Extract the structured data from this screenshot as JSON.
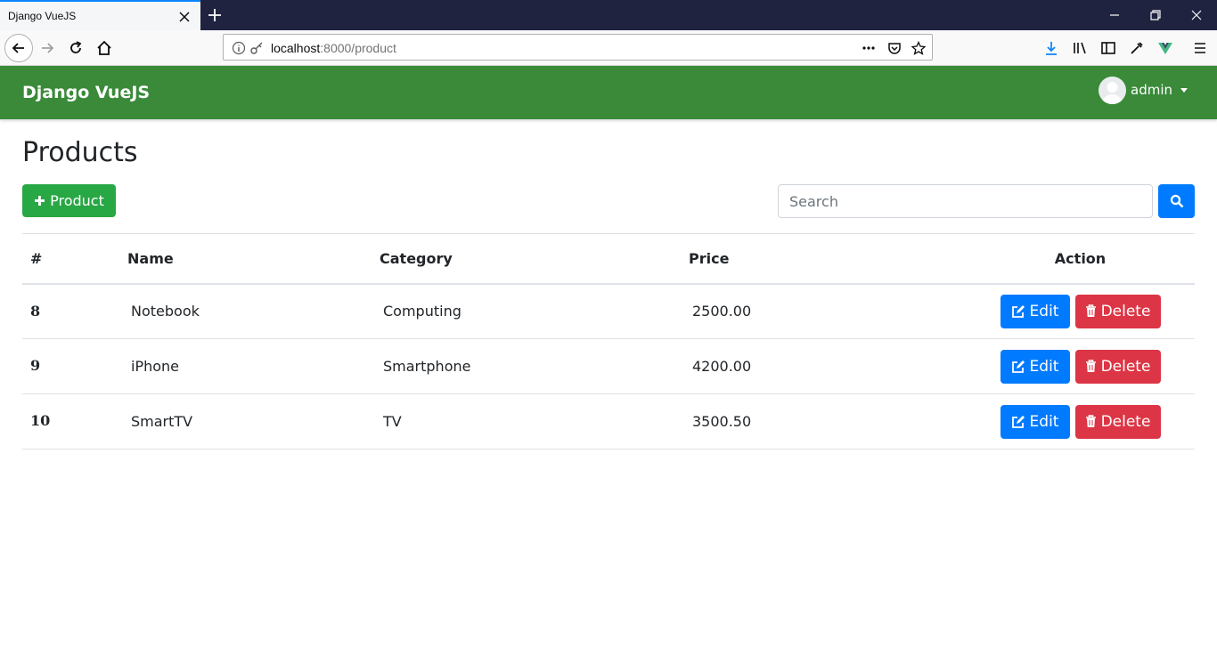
{
  "browser": {
    "tab_title": "Django VueJS",
    "url_host": "localhost",
    "url_path": ":8000/product"
  },
  "app": {
    "brand": "Django VueJS",
    "user": "admin",
    "accent_color": "#3a8a39"
  },
  "page": {
    "title": "Products",
    "add_button_label": "Product",
    "search_placeholder": "Search"
  },
  "table": {
    "headers": [
      "#",
      "Name",
      "Category",
      "Price",
      "Action"
    ],
    "rows": [
      {
        "id": "8",
        "name": "Notebook",
        "category": "Computing",
        "price": "2500.00"
      },
      {
        "id": "9",
        "name": "iPhone",
        "category": "Smartphone",
        "price": "4200.00"
      },
      {
        "id": "10",
        "name": "SmartTV",
        "category": "TV",
        "price": "3500.50"
      }
    ],
    "edit_label": "Edit",
    "delete_label": "Delete"
  }
}
